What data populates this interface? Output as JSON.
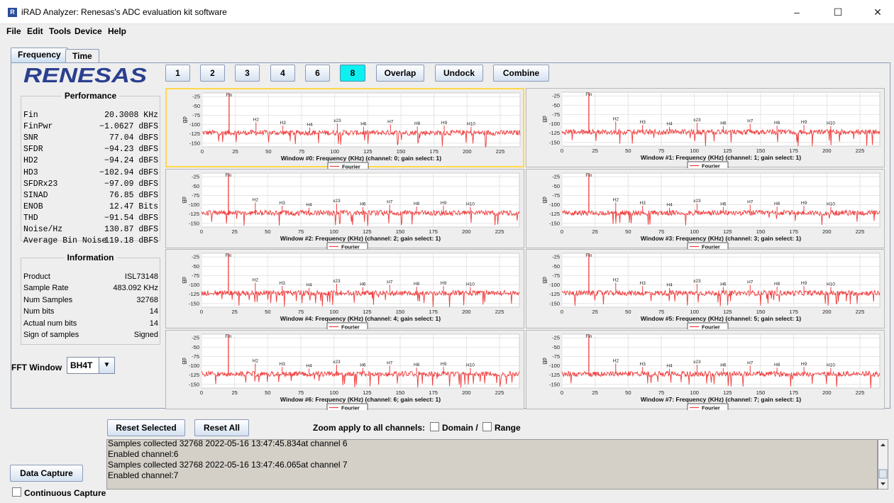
{
  "window": {
    "app_icon_text": "R",
    "title": "iRAD Analyzer: Renesas's ADC evaluation kit software",
    "minimize": "–",
    "maximize": "☐",
    "close": "✕"
  },
  "menu": [
    "File",
    "Edit",
    "Tools",
    "Device",
    "Help"
  ],
  "tabs": [
    {
      "label": "Frequency",
      "selected": true
    },
    {
      "label": "Time",
      "selected": false
    }
  ],
  "logo": "RENESAS",
  "window_buttons": [
    {
      "label": "1",
      "active": false
    },
    {
      "label": "2",
      "active": false
    },
    {
      "label": "3",
      "active": false
    },
    {
      "label": "4",
      "active": false
    },
    {
      "label": "6",
      "active": false
    },
    {
      "label": "8",
      "active": true
    },
    {
      "label": "Overlap",
      "active": false
    },
    {
      "label": "Undock",
      "active": false
    },
    {
      "label": "Combine",
      "active": false
    }
  ],
  "performance": {
    "title": "Performance",
    "rows": [
      {
        "label": "Fin",
        "value": "20.3008 KHz"
      },
      {
        "label": "FinPwr",
        "value": "−1.0627 dBFS"
      },
      {
        "label": "SNR",
        "value": "77.04 dBFS"
      },
      {
        "label": "SFDR",
        "value": "−94.23 dBFS"
      },
      {
        "label": "HD2",
        "value": "−94.24 dBFS"
      },
      {
        "label": "HD3",
        "value": "−102.94 dBFS"
      },
      {
        "label": "SFDRx23",
        "value": "−97.09 dBFS"
      },
      {
        "label": "SINAD",
        "value": "76.85 dBFS"
      },
      {
        "label": "ENOB",
        "value": "12.47 Bits"
      },
      {
        "label": "THD",
        "value": "−91.54 dBFS"
      },
      {
        "label": "Noise/Hz",
        "value": "130.87 dBFS"
      },
      {
        "label": "Average Bin Noise",
        "value": "119.18 dBFS"
      }
    ]
  },
  "information": {
    "title": "Information",
    "rows": [
      {
        "label": "Product",
        "value": "ISL73148"
      },
      {
        "label": "Sample Rate",
        "value": "483.092 KHz"
      },
      {
        "label": "Num Samples",
        "value": "32768"
      },
      {
        "label": "Num bits",
        "value": "14"
      },
      {
        "label": "Actual num bits",
        "value": "14"
      },
      {
        "label": "Sign of samples",
        "value": "Signed"
      }
    ]
  },
  "fft_window": {
    "label": "FFT Window",
    "value": "BH4T"
  },
  "chart_data": [
    {
      "type": "line",
      "title": "Window #0: Frequency (KHz) (channel: 0; gain select: 1)",
      "ylabel": "dB",
      "legend": "Fourier",
      "selected": true
    },
    {
      "type": "line",
      "title": "Window #1: Frequency (KHz) (channel: 1; gain select: 1)",
      "ylabel": "dB",
      "legend": "Fourier",
      "selected": false
    },
    {
      "type": "line",
      "title": "Window #2: Frequency (KHz) (channel: 2; gain select: 1)",
      "ylabel": "dB",
      "legend": "Fourier",
      "selected": false
    },
    {
      "type": "line",
      "title": "Window #3: Frequency (KHz) (channel: 3; gain select: 1)",
      "ylabel": "dB",
      "legend": "Fourier",
      "selected": false
    },
    {
      "type": "line",
      "title": "Window #4: Frequency (KHz) (channel: 4; gain select: 1)",
      "ylabel": "dB",
      "legend": "Fourier",
      "selected": false
    },
    {
      "type": "line",
      "title": "Window #5: Frequency (KHz) (channel: 5; gain select: 1)",
      "ylabel": "dB",
      "legend": "Fourier",
      "selected": false
    },
    {
      "type": "line",
      "title": "Window #6: Frequency (KHz) (channel: 6; gain select: 1)",
      "ylabel": "dB",
      "legend": "Fourier",
      "selected": false
    },
    {
      "type": "line",
      "title": "Window #7: Frequency (KHz) (channel: 7; gain select: 1)",
      "ylabel": "dB",
      "legend": "Fourier",
      "selected": false
    }
  ],
  "chart_common": {
    "xlim": [
      0,
      240
    ],
    "ylim": [
      -160,
      -15
    ],
    "x_ticks": [
      0,
      25,
      50,
      75,
      100,
      125,
      150,
      175,
      200,
      225
    ],
    "y_ticks": [
      -25,
      -50,
      -75,
      -100,
      -125,
      -150
    ],
    "noise_floor": -122,
    "fundamental": {
      "label": "Fin",
      "x": 20.3,
      "y": -1
    },
    "harmonics": [
      {
        "label": "H2",
        "x": 40.6,
        "y": -94
      },
      {
        "label": "H3",
        "x": 60.9,
        "y": -103
      },
      {
        "label": "H4",
        "x": 81.2,
        "y": -108
      },
      {
        "label": "x23",
        "x": 102,
        "y": -97
      },
      {
        "label": "H6",
        "x": 121.8,
        "y": -106
      },
      {
        "label": "H7",
        "x": 142.1,
        "y": -100
      },
      {
        "label": "H8",
        "x": 162.4,
        "y": -105
      },
      {
        "label": "H9",
        "x": 182.7,
        "y": -103
      },
      {
        "label": "H10",
        "x": 203,
        "y": -106
      }
    ],
    "line_color": "#f03c3c"
  },
  "controls": {
    "reset_selected": "Reset Selected",
    "reset_all": "Reset All",
    "zoom_label": "Zoom apply to all channels:",
    "domain_label": "Domain /",
    "range_label": "Range",
    "data_capture": "Data Capture",
    "continuous_capture": "Continuous Capture"
  },
  "log": [
    "Samples collected 32768  2022-05-16 13:47:45.834at channel 6",
    "Enabled channel:6",
    "Samples collected 32768  2022-05-16 13:47:46.065at channel 7",
    "Enabled channel:7"
  ]
}
